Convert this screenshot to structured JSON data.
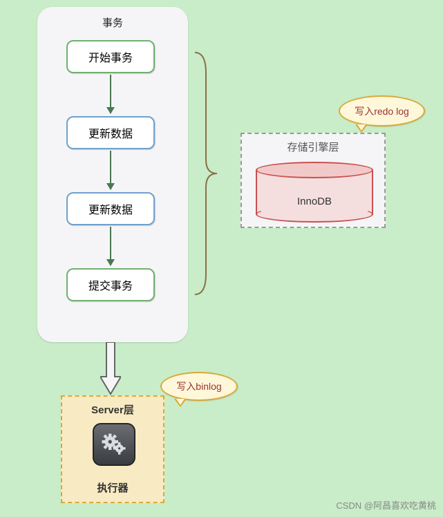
{
  "panel": {
    "title": "事务"
  },
  "steps": {
    "s1": "开始事务",
    "s2": "更新数据",
    "s3": "更新数据",
    "s4": "提交事务"
  },
  "storage": {
    "title": "存储引擎层",
    "engine": "InnoDB"
  },
  "bubbles": {
    "redo": "写入redo log",
    "binlog": "写入binlog"
  },
  "server": {
    "title": "Server层",
    "executor": "执行器"
  },
  "watermark": "CSDN @阿昌喜欢吃黄桃"
}
